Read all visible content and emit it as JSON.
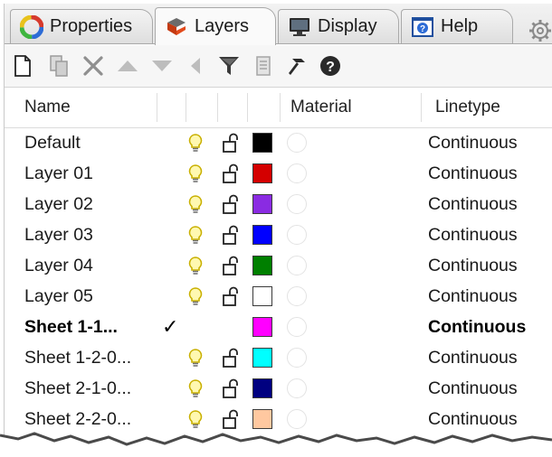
{
  "tabs": [
    {
      "label": "Properties",
      "icon": "properties-icon",
      "active": false
    },
    {
      "label": "Layers",
      "icon": "layers-icon",
      "active": true
    },
    {
      "label": "Display",
      "icon": "display-icon",
      "active": false
    },
    {
      "label": "Help",
      "icon": "help-icon",
      "active": false
    }
  ],
  "toolbar": {
    "icons": [
      "new-layer-icon",
      "new-sublayer-icon",
      "delete-icon",
      "move-up-icon",
      "move-down-icon",
      "move-to-parent-icon",
      "filter-icon",
      "layer-states-icon",
      "tools-icon",
      "help-icon"
    ]
  },
  "header": {
    "name": "Name",
    "material": "Material",
    "linetype": "Linetype"
  },
  "layers": [
    {
      "name": "Default",
      "visible": true,
      "locked": false,
      "current": false,
      "color": "#000000",
      "linetype": "Continuous"
    },
    {
      "name": "Layer 01",
      "visible": true,
      "locked": false,
      "current": false,
      "color": "#d40000",
      "linetype": "Continuous"
    },
    {
      "name": "Layer 02",
      "visible": true,
      "locked": false,
      "current": false,
      "color": "#8a2be2",
      "linetype": "Continuous"
    },
    {
      "name": "Layer 03",
      "visible": true,
      "locked": false,
      "current": false,
      "color": "#0000ff",
      "linetype": "Continuous"
    },
    {
      "name": "Layer 04",
      "visible": true,
      "locked": false,
      "current": false,
      "color": "#007f00",
      "linetype": "Continuous"
    },
    {
      "name": "Layer 05",
      "visible": true,
      "locked": false,
      "current": false,
      "color": "#ffffff",
      "linetype": "Continuous"
    },
    {
      "name": "Sheet  1-1...",
      "visible": true,
      "locked": false,
      "current": true,
      "color": "#ff00ff",
      "linetype": "Continuous"
    },
    {
      "name": "Sheet 1-2-0...",
      "visible": true,
      "locked": false,
      "current": false,
      "color": "#00ffff",
      "linetype": "Continuous"
    },
    {
      "name": "Sheet 2-1-0...",
      "visible": true,
      "locked": false,
      "current": false,
      "color": "#000080",
      "linetype": "Continuous"
    },
    {
      "name": "Sheet 2-2-0...",
      "visible": true,
      "locked": false,
      "current": false,
      "color": "#ffc8a0",
      "linetype": "Continuous"
    }
  ],
  "colors": {
    "bulb": "#e8d000",
    "accent_layers_tab": "#e24a1b"
  }
}
